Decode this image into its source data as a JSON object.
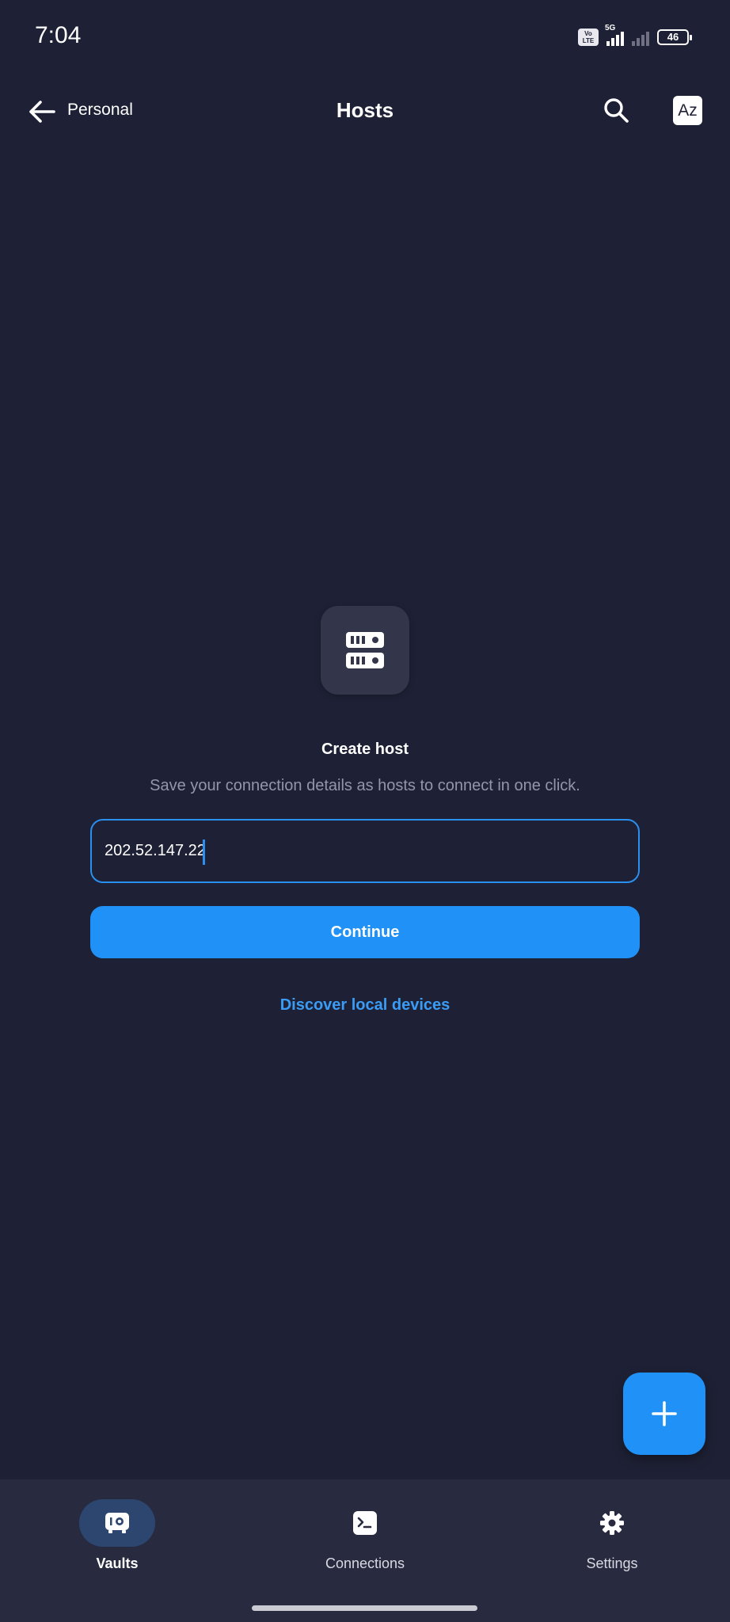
{
  "status_bar": {
    "time": "7:04",
    "network": "5G",
    "volte": "Vo LTE",
    "battery": "46"
  },
  "header": {
    "back_label": "Personal",
    "title": "Hosts",
    "sort_label": "Az"
  },
  "empty_state": {
    "icon": "server-icon",
    "title": "Create host",
    "description": "Save your connection details as hosts to connect in one click."
  },
  "host_input": {
    "value": "202.52.147.22"
  },
  "continue_label": "Continue",
  "discover_label": "Discover local devices",
  "fab_icon": "plus-icon",
  "bottom_nav": {
    "items": [
      {
        "label": "Vaults",
        "icon": "vault-icon",
        "active": true
      },
      {
        "label": "Connections",
        "icon": "terminal-icon",
        "active": false
      },
      {
        "label": "Settings",
        "icon": "gear-icon",
        "active": false
      }
    ]
  },
  "colors": {
    "background": "#1e2135",
    "accent": "#2091f6",
    "link": "#3a9cf5",
    "nav_background": "#282b3f"
  }
}
